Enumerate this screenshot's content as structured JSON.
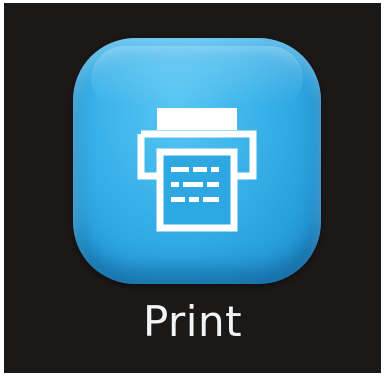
{
  "app": {
    "label": "Print",
    "icon": "printer-icon",
    "tile_color": "#2ea8e3",
    "background_color": "#1b1918",
    "label_color": "#f4f4f4"
  }
}
